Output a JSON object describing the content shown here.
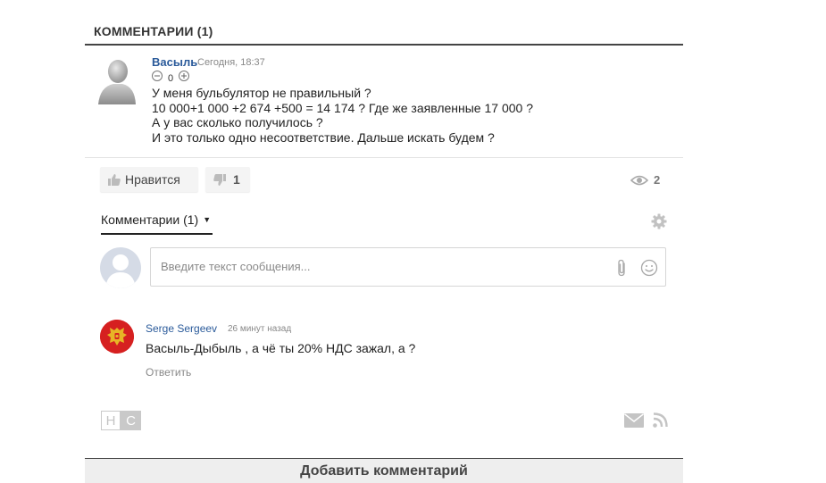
{
  "section": {
    "title": "КОММЕНТАРИИ (1)"
  },
  "comment1": {
    "author": "Васыль",
    "time": "Сегодня, 18:37",
    "rating": "0",
    "lines": [
      "У меня бульбулятор не правильный ?",
      "10 000+1 000 +2 674 +500 = 14 174 ? Где же заявленные 17 000 ?",
      "А у вас сколько получилось ?",
      "И это только одно несоответствие. Дальше искать будем ?"
    ]
  },
  "reactions": {
    "like_label": "Нравится",
    "dislike_count": "1",
    "views": "2"
  },
  "comments_tab": {
    "label": "Комментарии (1)"
  },
  "composer": {
    "placeholder": "Введите текст сообщения..."
  },
  "comment2": {
    "author": "Serge Sergeev",
    "time": "26 минут назад",
    "text": "Васыль-Дыбыль , а чё ты 20% НДС зажал, а ?",
    "reply_label": "Ответить"
  },
  "footer": {
    "logo_h": "Н",
    "logo_c": "С"
  },
  "add_comment": {
    "label": "Добавить комментарий"
  },
  "colors": {
    "link": "#2a5a9a",
    "muted": "#888888",
    "avatar_red": "#d62020"
  }
}
